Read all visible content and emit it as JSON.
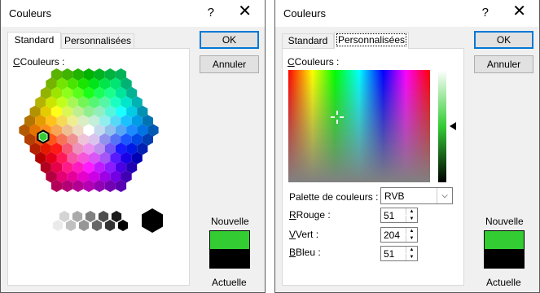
{
  "dialog_standard": {
    "title": "Couleurs",
    "help": "?",
    "close": "✕",
    "tabs": [
      {
        "label": "Standard"
      },
      {
        "label": "Personnalisées"
      }
    ],
    "colors_label": "Couleurs :",
    "ok": "OK",
    "cancel": "Annuler",
    "new_label": "Nouvelle",
    "current_label": "Actuelle"
  },
  "dialog_custom": {
    "title": "Couleurs",
    "help": "?",
    "close": "✕",
    "tabs": [
      {
        "label": "Standard"
      },
      {
        "label": "Personnalisées"
      }
    ],
    "colors_label": "Couleurs :",
    "ok": "OK",
    "cancel": "Annuler",
    "palette_label": "Palette de couleurs :",
    "palette_value": "RVB",
    "red_label": "Rouge :",
    "red_value": "51",
    "green_label": "Vert :",
    "green_value": "204",
    "blue_label": "Bleu :",
    "blue_value": "51",
    "new_label": "Nouvelle",
    "current_label": "Actuelle"
  },
  "colors": {
    "new": "#33cc33",
    "current": "#000000",
    "accent": "#0078d7"
  }
}
